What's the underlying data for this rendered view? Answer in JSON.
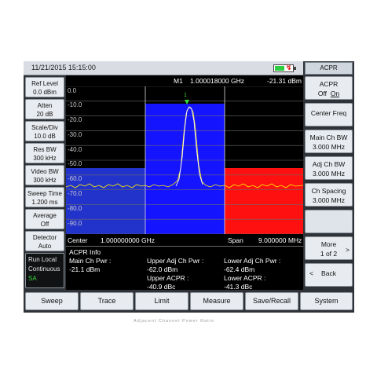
{
  "status": {
    "datetime": "11/21/2015  15:15:00"
  },
  "marker": {
    "label": "M1",
    "freq": "1.000018000 GHz",
    "level": "-21.31 dBm",
    "glyph": "1"
  },
  "left_params": [
    {
      "label": "Ref Level",
      "value": "0.0 dBm"
    },
    {
      "label": "Atten",
      "value": "20 dB"
    },
    {
      "label": "Scale/Div",
      "value": "10.0 dB"
    },
    {
      "label": "Res BW",
      "value": "300 kHz"
    },
    {
      "label": "Video BW",
      "value": "300 kHz"
    },
    {
      "label": "Sweep Time",
      "value": "1.200 ms"
    },
    {
      "label": "Average",
      "value": "Off"
    },
    {
      "label": "Detector",
      "value": "Auto"
    }
  ],
  "run_mode": {
    "line1": "Run  Local",
    "line2": "Continuous",
    "mode": "SA"
  },
  "y_ticks": [
    "0.0",
    "-10.0",
    "-20.0",
    "-30.0",
    "-40.0",
    "-50.0",
    "-60.0",
    "-70.0",
    "-80.0",
    "-90.0"
  ],
  "footer": {
    "center_label": "Center",
    "center_value": "1.000000000 GHz",
    "span_label": "Span",
    "span_value": "9.000000 MHz"
  },
  "acpr_info": {
    "title": "ACPR Info",
    "main_label": "Main Ch Pwr :",
    "main_value": "-21.1 dBm",
    "upper_adj_label": "Upper Adj Ch Pwr :",
    "upper_adj_value": "-62.0 dBm",
    "upper_acpr_label": "Upper ACPR :",
    "upper_acpr_value": "-40.9 dBc",
    "lower_adj_label": "Lower Adj Ch Pwr :",
    "lower_adj_value": "-62.4 dBm",
    "lower_acpr_label": "Lower ACPR :",
    "lower_acpr_value": "-41.3 dBc"
  },
  "softkeys": {
    "header": "ACPR",
    "acpr_toggle": {
      "label": "ACPR",
      "off": "Off",
      "on": "On"
    },
    "center_freq": "Center Freq",
    "main_ch_bw": {
      "label": "Main Ch BW",
      "value": "3.000 MHz"
    },
    "adj_ch_bw": {
      "label": "Adj Ch BW",
      "value": "3.000 MHz"
    },
    "ch_spacing": {
      "label": "Ch Spacing",
      "value": "3.000 MHz"
    },
    "more": {
      "label": "More",
      "page": "1 of 2",
      "arrow": ">"
    },
    "back": {
      "label": "Back",
      "arrow": "<"
    }
  },
  "menu": [
    "Sweep",
    "Trace",
    "Limit",
    "Measure",
    "Save/Recall",
    "System"
  ],
  "caption": "Adjacent Channel Power Ratio",
  "colors": {
    "main_channel": "#1414ff",
    "upper_adj_channel": "#ff1010",
    "lower_adj_channel": "#2233cc",
    "trace": "#ffee00",
    "grid": "#6a6a6a"
  }
}
